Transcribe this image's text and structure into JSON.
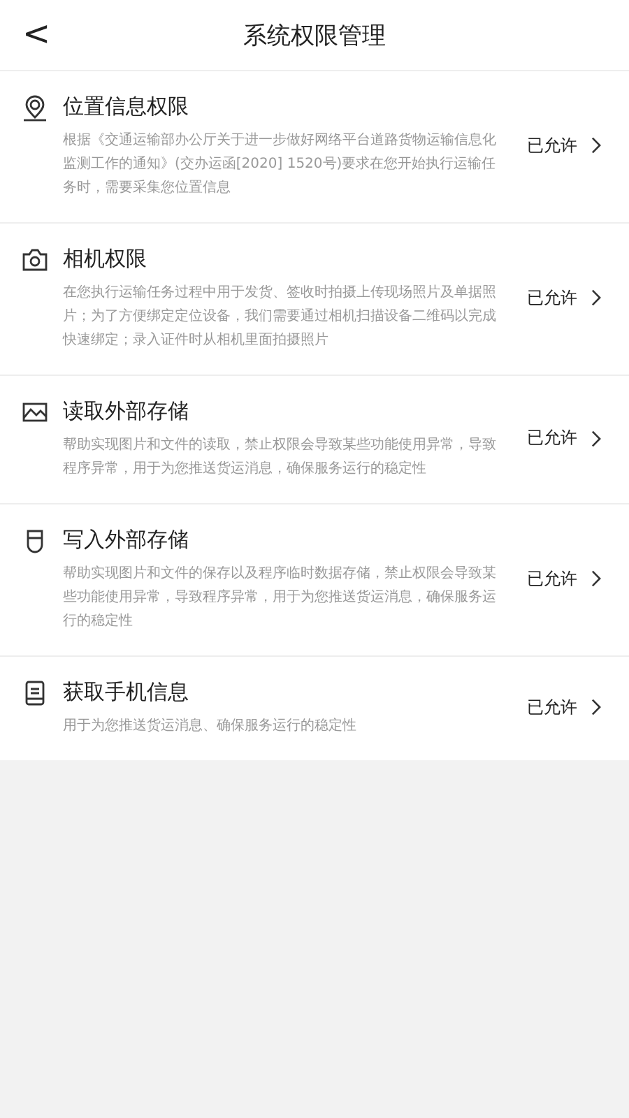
{
  "header": {
    "back": "<",
    "title": "系统权限管理"
  },
  "permissions": [
    {
      "kind": "location",
      "title": "位置信息权限",
      "description": "根据《交通运输部办公厅关于进一步做好网络平台道路货物运输信息化监测工作的通知》(交办运函[2020] 1520号)要求在您开始执行运输任务时，需要采集您位置信息",
      "status": "已允许"
    },
    {
      "kind": "camera",
      "title": "相机权限",
      "description": "在您执行运输任务过程中用于发货、签收时拍摄上传现场照片及单据照片；为了方便绑定定位设备，我们需要通过相机扫描设备二维码以完成快速绑定；录入证件时从相机里面拍摄照片",
      "status": "已允许"
    },
    {
      "kind": "image",
      "title": "读取外部存储",
      "description": "帮助实现图片和文件的读取，禁止权限会导致某些功能使用异常，导致程序异常，用于为您推送货运消息，确保服务运行的稳定性",
      "status": "已允许"
    },
    {
      "kind": "storage",
      "title": "写入外部存储",
      "description": "帮助实现图片和文件的保存以及程序临时数据存储，禁止权限会导致某些功能使用异常，导致程序异常，用于为您推送货运消息，确保服务运行的稳定性",
      "status": "已允许"
    },
    {
      "kind": "phone",
      "title": "获取手机信息",
      "description": "用于为您推送货运消息、确保服务运行的稳定性",
      "status": "已允许"
    }
  ]
}
